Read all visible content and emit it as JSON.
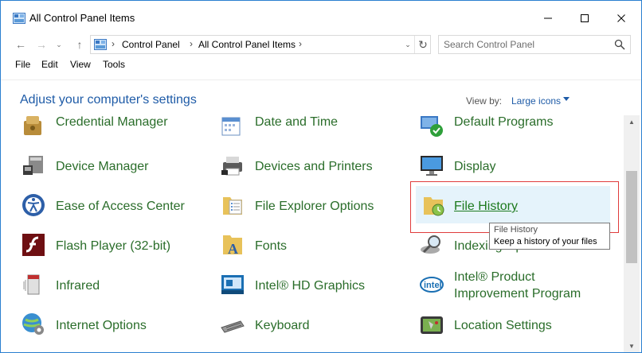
{
  "window": {
    "title": "All Control Panel Items",
    "controls": {
      "minimize": "—",
      "maximize": "☐",
      "close": "✕"
    }
  },
  "nav": {
    "back": "←",
    "forward": "→",
    "recent": "⌄",
    "up": "↑",
    "refresh": "↻",
    "dropdown": "⌄"
  },
  "breadcrumb": [
    {
      "label": "Control Panel"
    },
    {
      "label": "All Control Panel Items"
    }
  ],
  "breadcrumb_sep": "›",
  "search": {
    "placeholder": "Search Control Panel",
    "value": ""
  },
  "menu": [
    "File",
    "Edit",
    "View",
    "Tools"
  ],
  "content": {
    "heading": "Adjust your computer's settings",
    "view_by_label": "View by:",
    "view_by_value": "Large icons"
  },
  "items": [
    {
      "label": "Credential Manager",
      "icon": "credential-manager-icon",
      "color": "#c8a24c"
    },
    {
      "label": "Date and Time",
      "icon": "date-time-icon",
      "color": "#5a8fd0"
    },
    {
      "label": "Default Programs",
      "icon": "default-programs-icon",
      "color": "#2e9f3a"
    },
    {
      "label": "Device Manager",
      "icon": "device-manager-icon",
      "color": "#6a6a6a"
    },
    {
      "label": "Devices and Printers",
      "icon": "printer-icon",
      "color": "#6a6a6a"
    },
    {
      "label": "Display",
      "icon": "display-icon",
      "color": "#3a78c4"
    },
    {
      "label": "Ease of Access Center",
      "icon": "ease-of-access-icon",
      "color": "#2d5fa8"
    },
    {
      "label": "File Explorer Options",
      "icon": "folder-options-icon",
      "color": "#e8c25a"
    },
    {
      "label": "File History",
      "icon": "file-history-icon",
      "color": "#e8c25a"
    },
    {
      "label": "Flash Player (32-bit)",
      "icon": "flash-player-icon",
      "color": "#8b1a1a"
    },
    {
      "label": "Fonts",
      "icon": "fonts-icon",
      "color": "#e8c25a"
    },
    {
      "label": "Indexing Options",
      "icon": "indexing-options-icon",
      "color": "#8a8a8a"
    },
    {
      "label": "Infrared",
      "icon": "infrared-icon",
      "color": "#9a9a9a"
    },
    {
      "label": "Intel® HD Graphics",
      "icon": "intel-graphics-icon",
      "color": "#1a6fb3"
    },
    {
      "label": "Intel® Product",
      "label2": "Improvement Program",
      "icon": "intel-logo-icon",
      "color": "#1a6fb3"
    },
    {
      "label": "Internet Options",
      "icon": "internet-options-icon",
      "color": "#3a8fd0"
    },
    {
      "label": "Keyboard",
      "icon": "keyboard-icon",
      "color": "#7a7a7a"
    },
    {
      "label": "Location Settings",
      "icon": "location-settings-icon",
      "color": "#4a4a4a"
    }
  ],
  "tooltip": {
    "title": "File History",
    "description": "Keep a history of your files"
  },
  "scrollbar": {
    "up": "▲",
    "down": "▼"
  }
}
